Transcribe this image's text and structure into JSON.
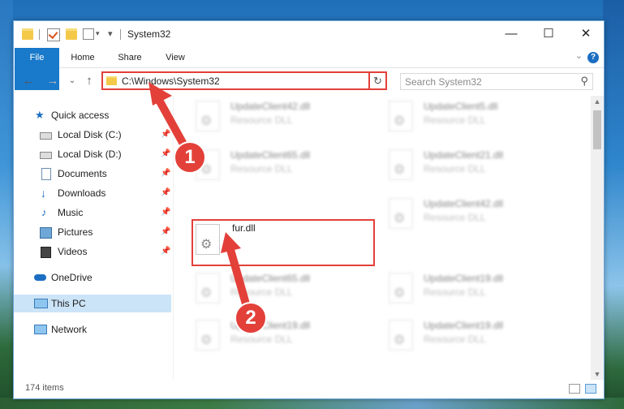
{
  "window": {
    "title": "System32",
    "controls": {
      "minimize": "—",
      "maximize": "☐",
      "close": "✕"
    }
  },
  "ribbon": {
    "tabs": [
      "File",
      "Home",
      "Share",
      "View"
    ],
    "help": "?"
  },
  "address_bar": {
    "path": "C:\\Windows\\System32",
    "search_placeholder": "Search System32"
  },
  "nav_pane": {
    "items": [
      {
        "label": "Quick access",
        "icon": "star-icon",
        "pinned": false
      },
      {
        "label": "Local Disk (C:)",
        "icon": "drive-icon",
        "pinned": true
      },
      {
        "label": "Local Disk (D:)",
        "icon": "drive-icon",
        "pinned": true
      },
      {
        "label": "Documents",
        "icon": "document-icon",
        "pinned": true
      },
      {
        "label": "Downloads",
        "icon": "download-icon",
        "pinned": true
      },
      {
        "label": "Music",
        "icon": "music-icon",
        "pinned": true
      },
      {
        "label": "Pictures",
        "icon": "picture-icon",
        "pinned": true
      },
      {
        "label": "Videos",
        "icon": "video-icon",
        "pinned": true
      },
      {
        "label": "OneDrive",
        "icon": "cloud-icon",
        "pinned": false
      },
      {
        "label": "This PC",
        "icon": "computer-icon",
        "pinned": false,
        "selected": true
      },
      {
        "label": "Network",
        "icon": "network-icon",
        "pinned": false
      }
    ]
  },
  "files": [
    {
      "name": "UpdateClient42.dll",
      "type": "Resource DLL",
      "blurred": true
    },
    {
      "name": "UpdateClient5.dll",
      "type": "Resource DLL",
      "blurred": true
    },
    {
      "name": "UpdateClient65.dll",
      "type": "Resource DLL",
      "blurred": true
    },
    {
      "name": "UpdateClient21.dll",
      "type": "Resource DLL",
      "blurred": true
    },
    {
      "name": "fur.dll",
      "type": "",
      "blurred": false,
      "highlighted": true
    },
    {
      "name": "UpdateClient42.dll",
      "type": "Resource DLL",
      "blurred": true
    },
    {
      "name": "UpdateClient65.dll",
      "type": "Resource DLL",
      "blurred": true
    },
    {
      "name": "UpdateClient19.dll",
      "type": "Resource DLL",
      "blurred": true
    },
    {
      "name": "UpdateClient19.dll",
      "type": "Resource DLL",
      "blurred": true
    },
    {
      "name": "UpdateClient19.dll",
      "type": "Resource DLL",
      "blurred": true
    }
  ],
  "status": {
    "item_count": "174 items"
  },
  "callouts": [
    "1",
    "2"
  ],
  "colors": {
    "accent": "#1979ca",
    "highlight": "#e3403a",
    "selection": "#cce4f7"
  }
}
